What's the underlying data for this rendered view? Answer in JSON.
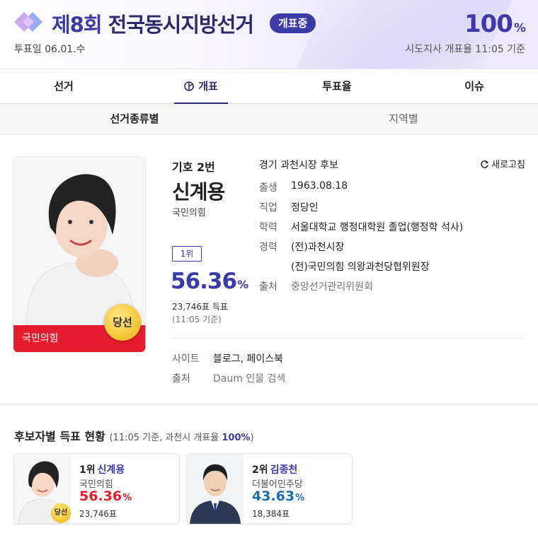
{
  "header": {
    "title_accent": "제8회",
    "title_rest": " 전국동시지방선거",
    "live_badge": "개표중",
    "date": "투표일 06.01.수",
    "rate_value": "100",
    "rate_unit": "%",
    "rate_sub": "시도지사 개표율 11:05 기준"
  },
  "tabs": [
    {
      "label": "선거"
    },
    {
      "label": "개표",
      "active": true
    },
    {
      "label": "투표율"
    },
    {
      "label": "이슈"
    }
  ],
  "subtabs": [
    {
      "label": "선거종류별",
      "active": true
    },
    {
      "label": "지역별"
    }
  ],
  "candidate": {
    "party_bar": "국민의힘",
    "win_badge": "당선",
    "number": "기호 2번",
    "name": "신계용",
    "party": "국민의힘",
    "rank": "1위",
    "pct_value": "56.36",
    "pct_unit": "%",
    "votes": "23,746표 득표",
    "time": "(11:05 기준)"
  },
  "info": {
    "title": "경기 과천시장 후보",
    "refresh": "새로고침",
    "rows": [
      {
        "label": "출생",
        "value": "1963.08.18"
      },
      {
        "label": "직업",
        "value": "정당인"
      },
      {
        "label": "학력",
        "value": "서울대학교 행정대학원 졸업(행정학 석사)"
      },
      {
        "label": "경력",
        "value": "(전)과천시장"
      },
      {
        "label": "",
        "value": "(전)국민의힘 의왕과천당협위원장"
      },
      {
        "label": "출처",
        "value": "중앙선거관리위원회"
      }
    ]
  },
  "site": {
    "site_label": "사이트",
    "site_value": "블로그, 페이스북",
    "source_label": "출처",
    "source_value": "Daum 인물 검색"
  },
  "section": {
    "title": "후보자별 득표 현황",
    "sub_prefix": "(11:05 기준, 과천시 개표율 ",
    "sub_rate": "100%",
    "sub_suffix": ")"
  },
  "results": [
    {
      "rank": "1위",
      "name": "신계용",
      "party": "국민의힘",
      "pct_value": "56.36",
      "pct_unit": "%",
      "votes": "23,746표",
      "win_badge": "당선",
      "pct_color": "#e51c2e"
    },
    {
      "rank": "2위",
      "name": "김종천",
      "party": "더불어민주당",
      "pct_value": "43.63",
      "pct_unit": "%",
      "votes": "18,384표",
      "pct_color": "#1a6db3"
    }
  ],
  "colors": {
    "brand": "#3c3aa6",
    "party_red": "#e51c2e",
    "party_blue": "#1a6db3"
  }
}
